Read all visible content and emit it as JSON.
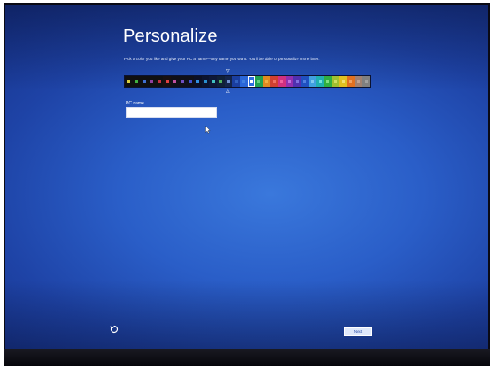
{
  "window": {
    "title": "Personalize",
    "subtitle": "Pick a color you like and give your PC a name—any name you want. You'll be able to personalize more later."
  },
  "palette": {
    "selected_index": 16,
    "swatches": [
      {
        "bg": "#101010",
        "chip": "#d8d040"
      },
      {
        "bg": "#101010",
        "chip": "#40b040"
      },
      {
        "bg": "#101010",
        "chip": "#4070d0"
      },
      {
        "bg": "#101010",
        "chip": "#9040a0"
      },
      {
        "bg": "#101010",
        "chip": "#c03040"
      },
      {
        "bg": "#181010",
        "chip": "#e04040"
      },
      {
        "bg": "#101018",
        "chip": "#c050a0"
      },
      {
        "bg": "#101018",
        "chip": "#7050c0"
      },
      {
        "bg": "#101018",
        "chip": "#4050d0"
      },
      {
        "bg": "#0c1024",
        "chip": "#3090e0"
      },
      {
        "bg": "#0c1430",
        "chip": "#2a8fd0"
      },
      {
        "bg": "#0e1838",
        "chip": "#40c0c0"
      },
      {
        "bg": "#102038",
        "chip": "#50b060"
      },
      {
        "bg": "#14244a",
        "chip": "#7090d0"
      },
      {
        "bg": "#1a3ea0",
        "chip": "#3060c0"
      },
      {
        "bg": "#2a66d8",
        "chip": "#4080e0"
      },
      {
        "bg": "#2c6ee0",
        "chip": "#ffffff"
      },
      {
        "bg": "#20a050",
        "chip": "#60d080"
      },
      {
        "bg": "#e08a20",
        "chip": "#f0b040"
      },
      {
        "bg": "#d04030",
        "chip": "#f07060"
      },
      {
        "bg": "#d03080",
        "chip": "#f060a0"
      },
      {
        "bg": "#9030b0",
        "chip": "#c070e0"
      },
      {
        "bg": "#5030b0",
        "chip": "#8070e0"
      },
      {
        "bg": "#2050c0",
        "chip": "#5080e0"
      },
      {
        "bg": "#40a0e0",
        "chip": "#80c8f0"
      },
      {
        "bg": "#20b0b0",
        "chip": "#70e0e0"
      },
      {
        "bg": "#30b040",
        "chip": "#80e080"
      },
      {
        "bg": "#a0c030",
        "chip": "#d0e060"
      },
      {
        "bg": "#e0c020",
        "chip": "#f0e070"
      },
      {
        "bg": "#e07020",
        "chip": "#f0a060"
      },
      {
        "bg": "#a08070",
        "chip": "#c0a090"
      },
      {
        "bg": "#808080",
        "chip": "#a0a0a0"
      }
    ]
  },
  "form": {
    "pc_name_label": "PC name",
    "pc_name_value": ""
  },
  "footer": {
    "next_label": "Next"
  },
  "colors": {
    "accent": "#2c6ee0",
    "background": "#2a5ec8"
  }
}
